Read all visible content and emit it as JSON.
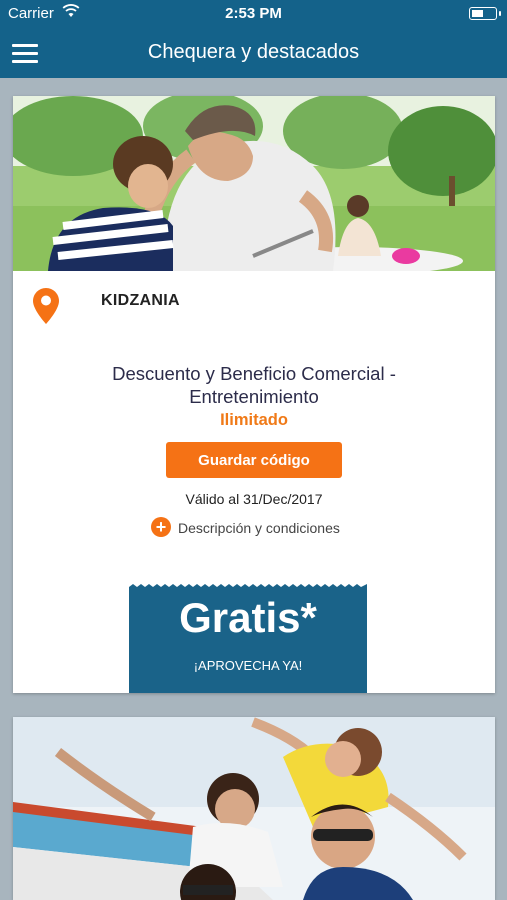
{
  "status_bar": {
    "carrier": "Carrier",
    "time": "2:53 PM"
  },
  "nav": {
    "title": "Chequera y destacados",
    "menu_icon": "hamburger-menu-icon"
  },
  "colors": {
    "primary": "#14628a",
    "accent": "#f57215",
    "limit_text": "#f07a18",
    "background": "#a8b5be"
  },
  "offer": {
    "brand": "KIDZANIA",
    "location_icon": "location-pin-icon",
    "benefit": "Descuento y Beneficio Comercial - Entretenimiento",
    "limit": "Ilimitado",
    "save_button": "Guardar código",
    "valid_until": "Válido al 31/Dec/2017",
    "description_link": "Descripción y condiciones",
    "description_icon": "plus-circle-icon",
    "promo_title": "Gratis*",
    "promo_subtitle": "¡APROVECHA YA!"
  }
}
